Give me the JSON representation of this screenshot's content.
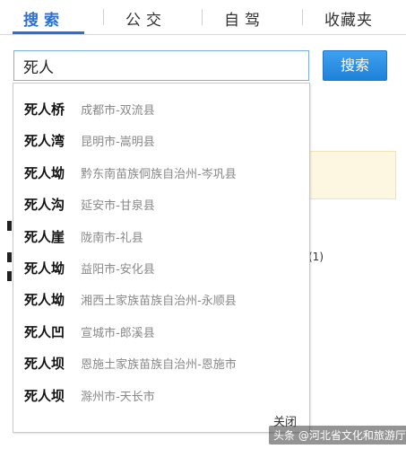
{
  "tabs": [
    {
      "label": "搜索",
      "active": true
    },
    {
      "label": "公交",
      "active": false
    },
    {
      "label": "自驾",
      "active": false
    },
    {
      "label": "收藏夹",
      "active": false
    }
  ],
  "search": {
    "value": "死人",
    "button_label": "搜索"
  },
  "suggestions": [
    {
      "name": "死人桥",
      "location": "成都市-双流县"
    },
    {
      "name": "死人湾",
      "location": "昆明市-嵩明县"
    },
    {
      "name": "死人坳",
      "location": "黔东南苗族侗族自治州-岑巩县"
    },
    {
      "name": "死人沟",
      "location": "延安市-甘泉县"
    },
    {
      "name": "死人崖",
      "location": "陇南市-礼县"
    },
    {
      "name": "死人坳",
      "location": "益阳市-安化县"
    },
    {
      "name": "死人坳",
      "location": "湘西土家族苗族自治州-永顺县"
    },
    {
      "name": "死人凹",
      "location": "宣城市-郎溪县"
    },
    {
      "name": "死人坝",
      "location": "恩施土家族苗族自治州-恩施市"
    },
    {
      "name": "死人坝",
      "location": "滁州市-天长市"
    }
  ],
  "dropdown": {
    "close_label": "关闭"
  },
  "background": {
    "fragment_text": "(1)"
  },
  "watermark": {
    "text": "头条 @河北省文化和旅游厅"
  },
  "colors": {
    "accent": "#2b6fd1",
    "button": "#1f82da",
    "highlight_bg": "#fdf6e0"
  }
}
